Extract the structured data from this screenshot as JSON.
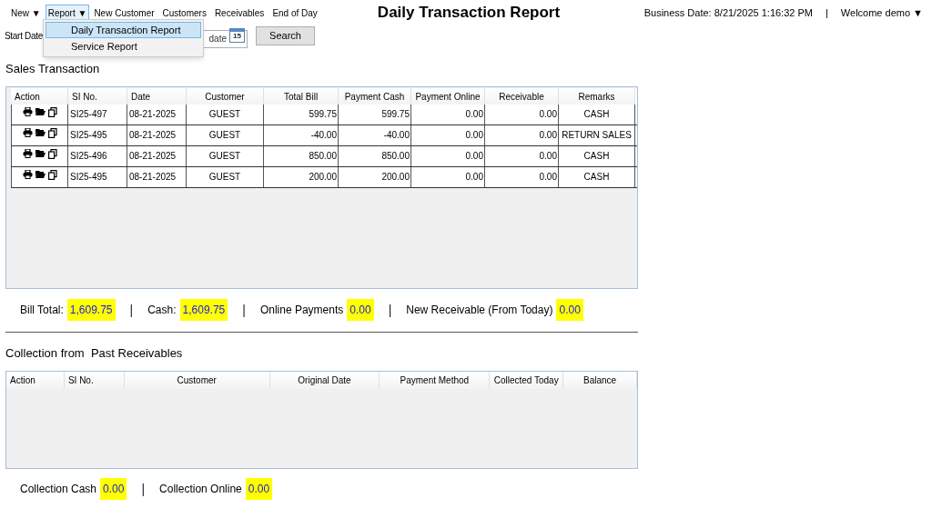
{
  "menu": [
    {
      "label": "New ▼",
      "open": false
    },
    {
      "label": "Report ▼",
      "open": true
    },
    {
      "label": "New Customer",
      "open": false
    },
    {
      "label": "Customers",
      "open": false
    },
    {
      "label": "Receivables",
      "open": false
    },
    {
      "label": "End of Day",
      "open": false
    }
  ],
  "title": "Daily Transaction Report",
  "business_date": "Business Date: 8/21/2025 1:16:32 PM",
  "separator": "|",
  "user_menu": "Welcome demo ▼",
  "dropdown": [
    {
      "label": "Daily Transaction Report",
      "selected": true
    },
    {
      "label": "Service Report",
      "selected": false
    }
  ],
  "filter": {
    "start_label": "Start Date",
    "date_field": {
      "placeholder": "date",
      "calendar": "15"
    },
    "search_button": "Search"
  },
  "sales": {
    "title": "Sales Transaction",
    "columns": [
      "Action",
      "SI No.",
      "Date",
      "Customer",
      "Total Bill",
      "Payment Cash",
      "Payment Online",
      "Receivable",
      "Remarks"
    ],
    "rows": [
      {
        "si": "SI25-497",
        "date": "08-21-2025",
        "customer": "GUEST",
        "total": "599.75",
        "cash": "599.75",
        "online": "0.00",
        "receivable": "0.00",
        "remarks": "CASH"
      },
      {
        "si": "SI25-495",
        "date": "08-21-2025",
        "customer": "GUEST",
        "total": "-40.00",
        "cash": "-40.00",
        "online": "0.00",
        "receivable": "0.00",
        "remarks": "RETURN SALES"
      },
      {
        "si": "SI25-496",
        "date": "08-21-2025",
        "customer": "GUEST",
        "total": "850.00",
        "cash": "850.00",
        "online": "0.00",
        "receivable": "0.00",
        "remarks": "CASH"
      },
      {
        "si": "SI25-495",
        "date": "08-21-2025",
        "customer": "GUEST",
        "total": "200.00",
        "cash": "200.00",
        "online": "0.00",
        "receivable": "0.00",
        "remarks": "CASH"
      }
    ],
    "totals": [
      {
        "label": "Bill Total:",
        "value": "1,609.75"
      },
      {
        "label": "Cash:",
        "value": "1,609.75"
      },
      {
        "label": "Online Payments",
        "value": "0.00"
      },
      {
        "label": "New Receivable (From Today)",
        "value": "0.00"
      }
    ]
  },
  "collection": {
    "title": "Collection from  Past Receivables",
    "columns": [
      "Action",
      "SI No.",
      "Customer",
      "Original Date",
      "Payment Method",
      "Collected Today",
      "Balance"
    ],
    "totals": [
      {
        "label": "Collection Cash",
        "value": "0.00"
      },
      {
        "label": "Collection Online",
        "value": "0.00"
      }
    ]
  }
}
